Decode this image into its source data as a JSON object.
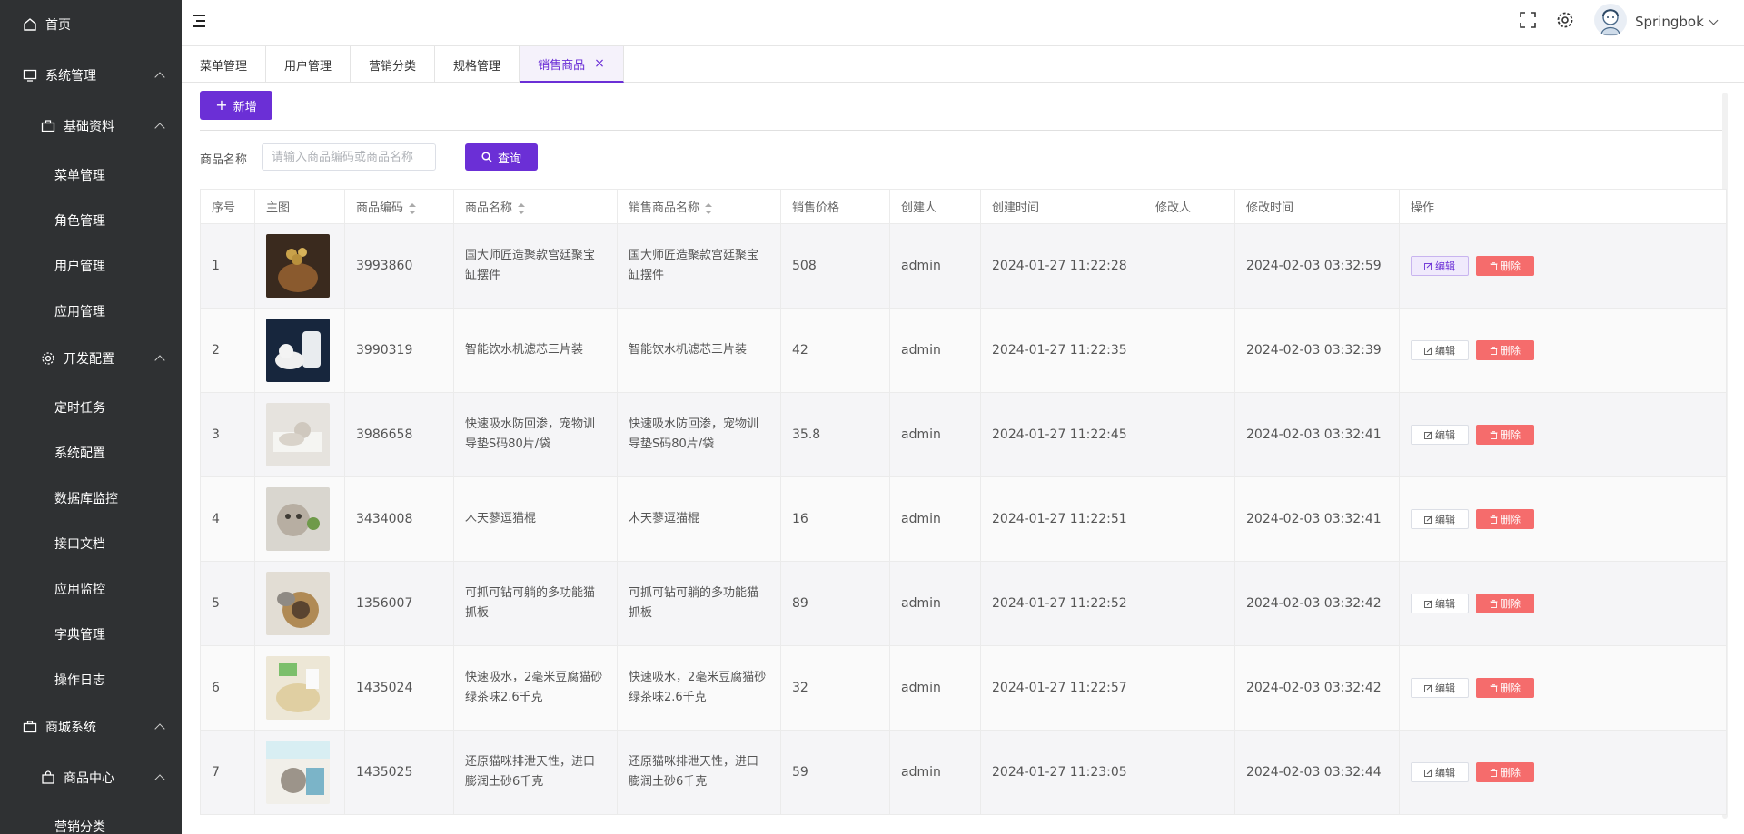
{
  "sidebar": {
    "items": [
      {
        "label": "首页",
        "icon": "home-icon",
        "level": 1
      },
      {
        "label": "系统管理",
        "icon": "monitor-icon",
        "level": 1
      },
      {
        "label": "基础资料",
        "icon": "briefcase-icon",
        "level": 2
      },
      {
        "label": "菜单管理",
        "level": 3
      },
      {
        "label": "角色管理",
        "level": 3
      },
      {
        "label": "用户管理",
        "level": 3
      },
      {
        "label": "应用管理",
        "level": 3
      },
      {
        "label": "开发配置",
        "icon": "gear-icon",
        "level": 2
      },
      {
        "label": "定时任务",
        "level": 3
      },
      {
        "label": "系统配置",
        "level": 3
      },
      {
        "label": "数据库监控",
        "level": 3
      },
      {
        "label": "接口文档",
        "level": 3
      },
      {
        "label": "应用监控",
        "level": 3
      },
      {
        "label": "字典管理",
        "level": 3
      },
      {
        "label": "操作日志",
        "level": 3
      },
      {
        "label": "商城系统",
        "icon": "briefcase-icon",
        "level": 1
      },
      {
        "label": "商品中心",
        "icon": "bag-icon",
        "level": 2
      },
      {
        "label": "营销分类",
        "level": 3
      }
    ]
  },
  "header": {
    "username": "Springbok"
  },
  "tabs": [
    {
      "label": "菜单管理"
    },
    {
      "label": "用户管理"
    },
    {
      "label": "营销分类"
    },
    {
      "label": "规格管理"
    },
    {
      "label": "销售商品",
      "active": true,
      "close": "×"
    }
  ],
  "toolbar": {
    "add_label": "新增",
    "add_plus": "+"
  },
  "search": {
    "label": "商品名称",
    "placeholder": "请输入商品编码或商品名称",
    "button_label": "查询"
  },
  "table": {
    "columns": [
      "序号",
      "主图",
      "商品编码",
      "商品名称",
      "销售商品名称",
      "销售价格",
      "创建人",
      "创建时间",
      "修改人",
      "修改时间",
      "操作"
    ],
    "edit_label": "编辑",
    "delete_label": "删除",
    "rows": [
      {
        "index": "1",
        "code": "3993860",
        "name": "国大师匠造聚款宫廷聚宝缸摆件",
        "sale_name": "国大师匠造聚款宫廷聚宝缸摆件",
        "price": "508",
        "creator": "admin",
        "created": "2024-01-27 11:22:28",
        "modifier": "",
        "modified": "2024-02-03 03:32:59"
      },
      {
        "index": "2",
        "code": "3990319",
        "name": "智能饮水机滤芯三片装",
        "sale_name": "智能饮水机滤芯三片装",
        "price": "42",
        "creator": "admin",
        "created": "2024-01-27 11:22:35",
        "modifier": "",
        "modified": "2024-02-03 03:32:39"
      },
      {
        "index": "3",
        "code": "3986658",
        "name": "快速吸水防回渗，宠物训导垫S码80片/袋",
        "sale_name": "快速吸水防回渗，宠物训导垫S码80片/袋",
        "price": "35.8",
        "creator": "admin",
        "created": "2024-01-27 11:22:45",
        "modifier": "",
        "modified": "2024-02-03 03:32:41"
      },
      {
        "index": "4",
        "code": "3434008",
        "name": "木天蓼逗猫棍",
        "sale_name": "木天蓼逗猫棍",
        "price": "16",
        "creator": "admin",
        "created": "2024-01-27 11:22:51",
        "modifier": "",
        "modified": "2024-02-03 03:32:41"
      },
      {
        "index": "5",
        "code": "1356007",
        "name": "可抓可钻可躺的多功能猫抓板",
        "sale_name": "可抓可钻可躺的多功能猫抓板",
        "price": "89",
        "creator": "admin",
        "created": "2024-01-27 11:22:52",
        "modifier": "",
        "modified": "2024-02-03 03:32:42"
      },
      {
        "index": "6",
        "code": "1435024",
        "name": "快速吸水，2毫米豆腐猫砂绿茶味2.6千克",
        "sale_name": "快速吸水，2毫米豆腐猫砂绿茶味2.6千克",
        "price": "32",
        "creator": "admin",
        "created": "2024-01-27 11:22:57",
        "modifier": "",
        "modified": "2024-02-03 03:32:42"
      },
      {
        "index": "7",
        "code": "1435025",
        "name": "还原猫咪排泄天性，进口膨润土砂6千克",
        "sale_name": "还原猫咪排泄天性，进口膨润土砂6千克",
        "price": "59",
        "creator": "admin",
        "created": "2024-01-27 11:23:05",
        "modifier": "",
        "modified": "2024-02-03 03:32:44"
      }
    ]
  },
  "colors": {
    "primary": "#6b2fd6",
    "danger": "#f56c6c",
    "sidebar_bg": "#2f3133"
  }
}
